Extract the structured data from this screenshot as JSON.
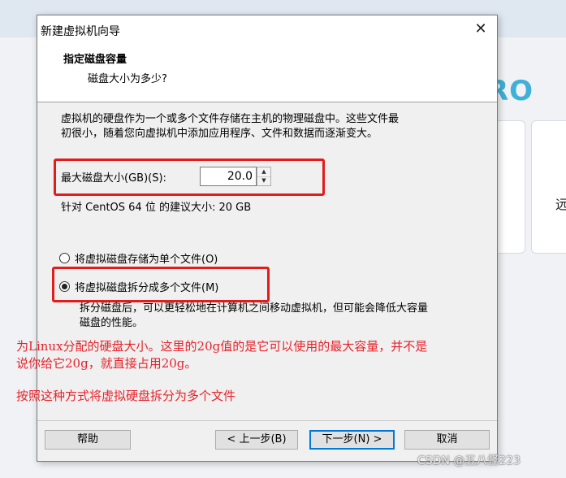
{
  "background": {
    "logo_text": "RO",
    "card_text": "远"
  },
  "dialog": {
    "title": "新建虚拟机向导",
    "close_glyph": "✕"
  },
  "header": {
    "title": "指定磁盘容量",
    "subtitle": "磁盘大小为多少?"
  },
  "description": {
    "line1": "虚拟机的硬盘作为一个或多个文件存储在主机的物理磁盘中。这些文件最",
    "line2": "初很小，随着您向虚拟机中添加应用程序、文件和数据而逐渐变大。"
  },
  "disk_size": {
    "label": "最大磁盘大小(GB)(S):",
    "value": "20.0",
    "up_glyph": "▲",
    "down_glyph": "▼"
  },
  "recommended": "针对 CentOS 64 位 的建议大小: 20 GB",
  "options": {
    "single_file": {
      "label": "将虚拟磁盘存储为单个文件(O)",
      "selected": false
    },
    "multi_file": {
      "label": "将虚拟磁盘拆分成多个文件(M)",
      "selected": true
    }
  },
  "split_description": {
    "line1": "拆分磁盘后，可以更轻松地在计算机之间移动虚拟机，但可能会降低大容量",
    "line2": "磁盘的性能。"
  },
  "annotations": {
    "line1": "为Linux分配的硬盘大小。这里的20g值的是它可以使用的最大容量，并不是",
    "line2": "说你给它20g，就直接占用20g。",
    "line3": "按照这种方式将虚拟硬盘拆分为多个文件"
  },
  "buttons": {
    "help": "帮助",
    "back": "< 上一步(B)",
    "next": "下一步(N) >",
    "cancel": "取消"
  },
  "watermark": "CSDN @五八怪223",
  "colors": {
    "annotation_red": "#e21b1b",
    "default_button_border": "#0078d7",
    "logo_accent": "#3fb0d8"
  }
}
